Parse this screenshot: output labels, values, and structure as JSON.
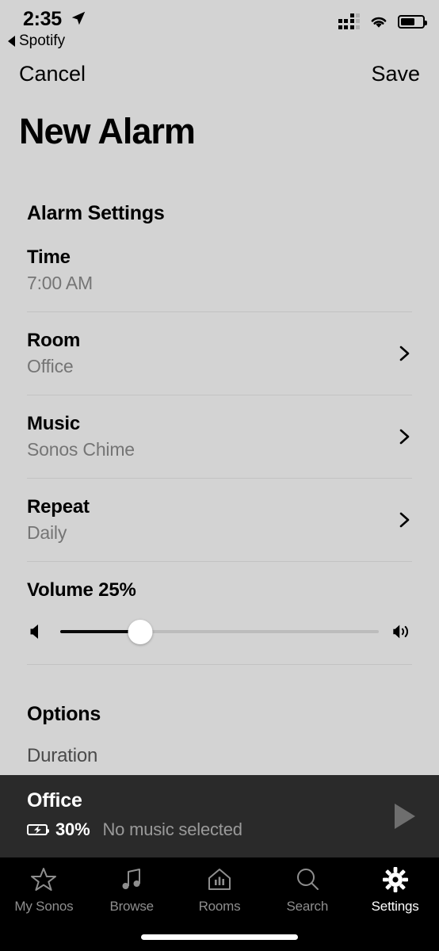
{
  "status_bar": {
    "time": "2:35",
    "back_label": "Spotify",
    "location_icon": "location-arrow-icon",
    "cellular_icon": "cellular-signal-icon",
    "wifi_icon": "wifi-icon",
    "battery_icon": "battery-icon"
  },
  "nav": {
    "cancel_label": "Cancel",
    "save_label": "Save"
  },
  "page": {
    "title": "New Alarm"
  },
  "alarm_settings": {
    "heading": "Alarm Settings",
    "rows": [
      {
        "label": "Time",
        "value": "7:00 AM",
        "chevron": false
      },
      {
        "label": "Room",
        "value": "Office",
        "chevron": true
      },
      {
        "label": "Music",
        "value": "Sonos Chime",
        "chevron": true
      },
      {
        "label": "Repeat",
        "value": "Daily",
        "chevron": true
      }
    ],
    "volume": {
      "label": "Volume 25%",
      "percent": 25,
      "min_icon": "speaker-low-icon",
      "max_icon": "speaker-high-icon"
    }
  },
  "options": {
    "heading": "Options",
    "rows": [
      {
        "label": "Duration"
      }
    ]
  },
  "now_playing": {
    "room": "Office",
    "battery_percent": "30%",
    "battery_icon": "battery-charging-icon",
    "music_status": "No music selected",
    "play_icon": "play-icon"
  },
  "tab_bar": {
    "items": [
      {
        "label": "My Sonos",
        "icon": "star-icon",
        "active": false
      },
      {
        "label": "Browse",
        "icon": "music-notes-icon",
        "active": false
      },
      {
        "label": "Rooms",
        "icon": "house-bars-icon",
        "active": false
      },
      {
        "label": "Search",
        "icon": "search-icon",
        "active": false
      },
      {
        "label": "Settings",
        "icon": "gear-icon",
        "active": true
      }
    ]
  },
  "colors": {
    "background": "#d3d3d3",
    "now_playing_bg": "#232323",
    "tab_bar_bg": "#000000",
    "divider": "#c3c3c3",
    "secondary_text": "#757575",
    "active_tab": "#ffffff",
    "inactive_tab": "#8e8e8e"
  }
}
